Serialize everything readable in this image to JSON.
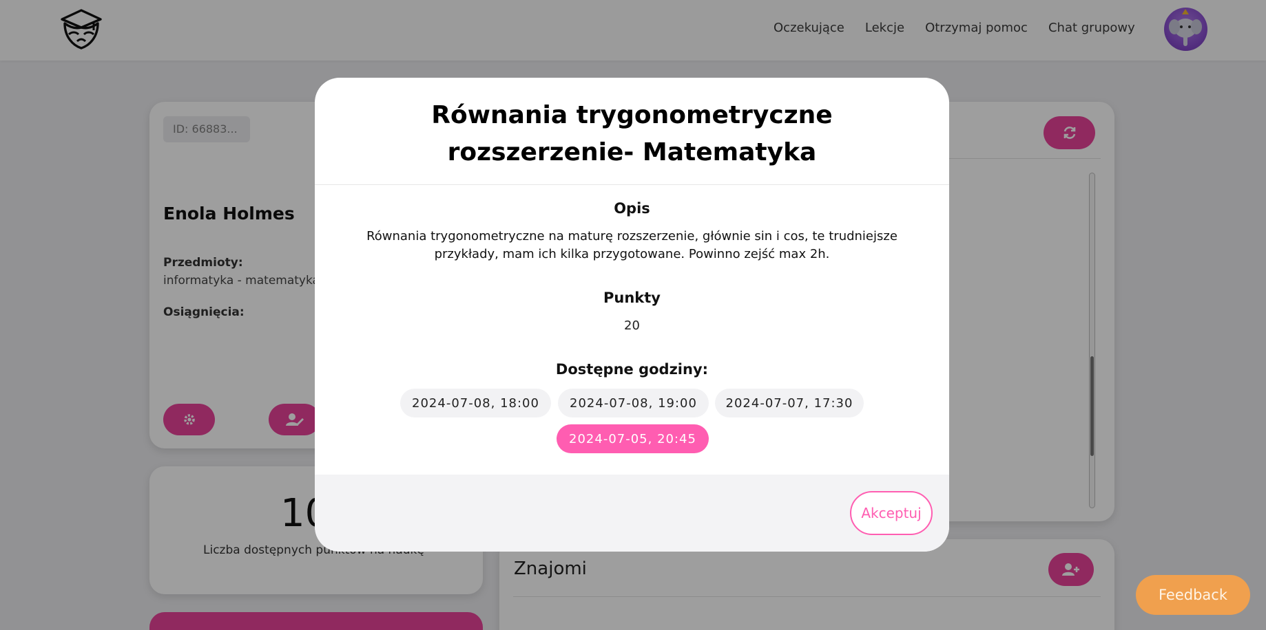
{
  "header": {
    "nav": [
      "Oczekujące",
      "Lekcje",
      "Otrzymaj pomoc",
      "Chat grupowy"
    ],
    "logo_icon": "graduation-cap-mask-logo",
    "avatar_icon": "elephant-avatar"
  },
  "profile": {
    "id": "ID: 66883...",
    "name": "Enola Holmes",
    "subjects_label": "Przedmioty:",
    "subjects_value": "informatyka - matematyka",
    "achievements_label": "Osiągnięcia:",
    "settings_icon": "gear-icon",
    "edit_icon": "user-edit-icon"
  },
  "points_card": {
    "value": "10",
    "label": "Liczba dostępnych punktów na naukę"
  },
  "right_panel": {
    "refresh_icon": "refresh-icon",
    "scrollbar_position": 0.55
  },
  "friends": {
    "title": "Znajomi",
    "add_icon": "user-plus-icon"
  },
  "modal": {
    "title": "Równania trygonometryczne rozszerzenie- Matematyka",
    "description_heading": "Opis",
    "description": "Równania trygonometryczne na maturę rozszerzenie, głównie sin i cos, te trudniejsze przykłady, mam ich kilka przygotowane. Powinno zejść max 2h.",
    "points_heading": "Punkty",
    "points_value": "20",
    "hours_heading": "Dostępne godziny:",
    "slots": [
      "2024-07-08, 18:00",
      "2024-07-08, 19:00",
      "2024-07-07, 17:30",
      "2024-07-05, 20:45"
    ],
    "selected_slot": "2024-07-05, 20:45",
    "accept_label": "Akceptuj"
  },
  "feedback": {
    "label": "Feedback"
  },
  "colors": {
    "pink": "#e8439a",
    "pink_light": "#ff5db1",
    "orange": "#f0a04e"
  }
}
